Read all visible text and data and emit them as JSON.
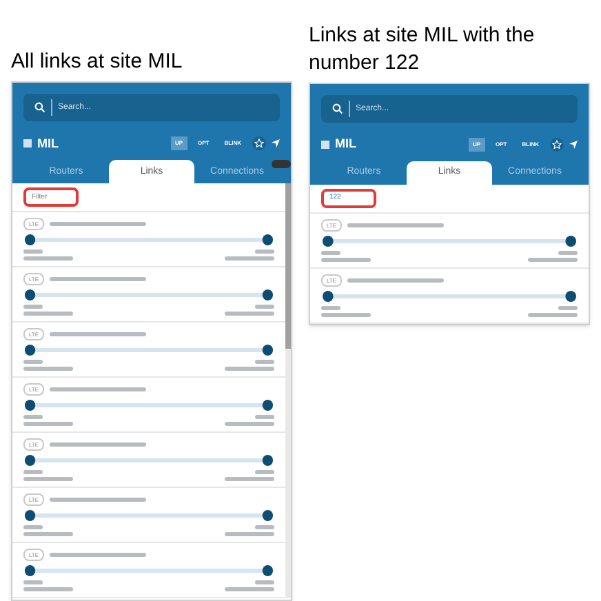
{
  "panels": [
    {
      "caption": "All links at site MIL",
      "search": {
        "placeholder": "Search..."
      },
      "site": "MIL",
      "buttons": [
        {
          "label": "UP",
          "selected": true
        },
        {
          "label": "OPT",
          "selected": false
        },
        {
          "label": "BLINK",
          "selected": false
        }
      ],
      "tooltip_shown": true,
      "tabs": [
        {
          "label": "Routers",
          "selected": false
        },
        {
          "label": "Links",
          "selected": true
        },
        {
          "label": "Connections",
          "selected": false
        }
      ],
      "filter": {
        "placeholder": "Filter"
      },
      "scrollbar": true,
      "links": [
        {
          "badge": "LTE"
        },
        {
          "badge": "LTE"
        },
        {
          "badge": "LTE"
        },
        {
          "badge": "LTE"
        },
        {
          "badge": "LTE"
        },
        {
          "badge": "LTE"
        },
        {
          "badge": "LTE"
        }
      ]
    },
    {
      "caption": "Links at site MIL with the number 122",
      "search": {
        "placeholder": "Search..."
      },
      "site": "MIL",
      "buttons": [
        {
          "label": "UP",
          "selected": true
        },
        {
          "label": "OPT",
          "selected": false
        },
        {
          "label": "BLINK",
          "selected": false
        }
      ],
      "tooltip_shown": false,
      "tabs": [
        {
          "label": "Routers",
          "selected": false
        },
        {
          "label": "Links",
          "selected": true
        },
        {
          "label": "Connections",
          "selected": false
        }
      ],
      "filter": {
        "value": "122"
      },
      "scrollbar": false,
      "links": [
        {
          "badge": "LTE"
        },
        {
          "badge": "LTE"
        }
      ]
    }
  ]
}
